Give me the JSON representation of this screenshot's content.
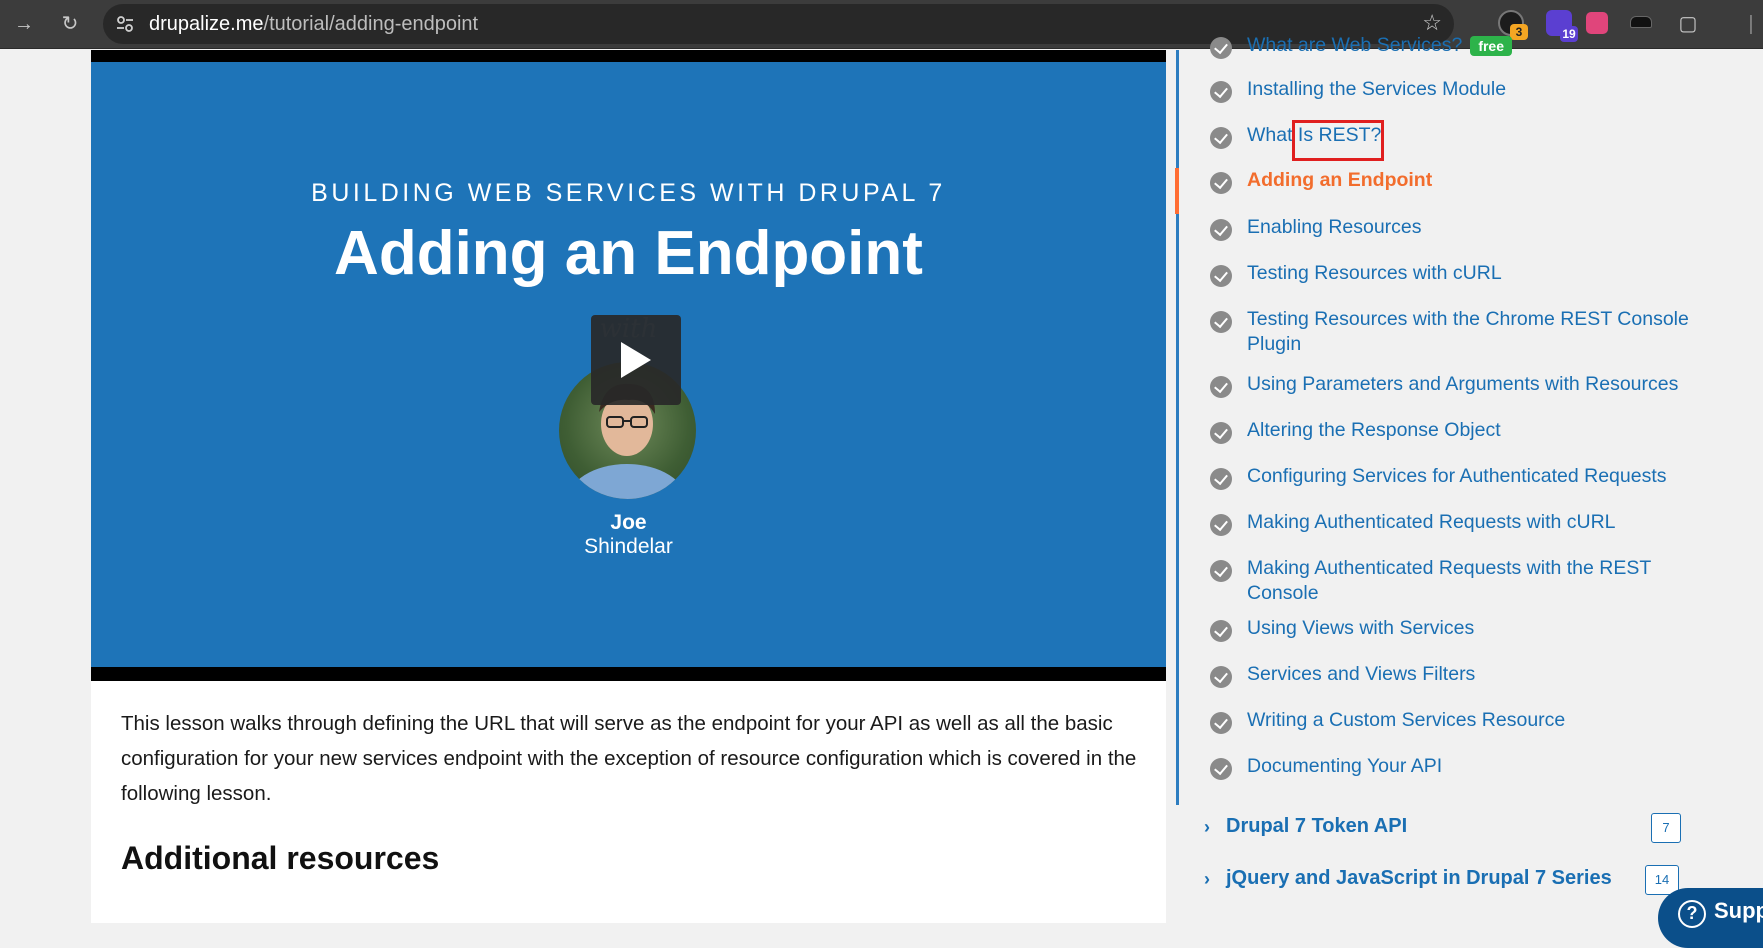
{
  "browser": {
    "url_host": "drupalize.me",
    "url_path": "/tutorial/adding-endpoint",
    "extensions": [
      {
        "icon": "extension-dark-icon",
        "badge": "3",
        "badge_color": "#f5a623"
      },
      {
        "icon": "extension-purple-icon",
        "badge": "19",
        "badge_color": "#5b3fd1"
      },
      {
        "icon": "translate-icon",
        "badge": ""
      },
      {
        "icon": "hat-icon",
        "badge": ""
      },
      {
        "icon": "puzzle-icon",
        "badge": ""
      }
    ]
  },
  "video": {
    "series": "BUILDING WEB SERVICES WITH DRUPAL 7",
    "title": "Adding an Endpoint",
    "with": "with",
    "presenter_first": "Joe",
    "presenter_last": "Shindelar"
  },
  "content": {
    "description": "This lesson walks through defining the URL that will serve as the endpoint for your API as well as all the basic configuration for your new services endpoint with the exception of resource configuration which is covered in the following lesson.",
    "additional_heading": "Additional resources"
  },
  "sidebar": {
    "lessons": [
      {
        "title": "What are Web Services?",
        "badge": "free"
      },
      {
        "title": "Installing the Services Module"
      },
      {
        "title": "What Is REST?"
      },
      {
        "title": "Adding an Endpoint",
        "active": true
      },
      {
        "title": "Enabling Resources"
      },
      {
        "title": "Testing Resources with cURL"
      },
      {
        "title": "Testing Resources with the Chrome REST Console Plugin"
      },
      {
        "title": "Using Parameters and Arguments with Resources"
      },
      {
        "title": "Altering the Response Object"
      },
      {
        "title": "Configuring Services for Authenticated Requests"
      },
      {
        "title": "Making Authenticated Requests with cURL"
      },
      {
        "title": "Making Authenticated Requests with the REST Console"
      },
      {
        "title": "Using Views with Services"
      },
      {
        "title": "Services and Views Filters"
      },
      {
        "title": "Writing a Custom Services Resource"
      },
      {
        "title": "Documenting Your API"
      }
    ],
    "series": [
      {
        "title": "Drupal 7 Token API",
        "count": "7"
      },
      {
        "title": "jQuery and JavaScript in Drupal 7 Series",
        "count": "14"
      }
    ],
    "support_label": "Supp"
  },
  "colors": {
    "link": "#1a6fb3",
    "active": "#f26d2d",
    "video_bg": "#1e74b8",
    "highlight": "#e01f1f"
  }
}
